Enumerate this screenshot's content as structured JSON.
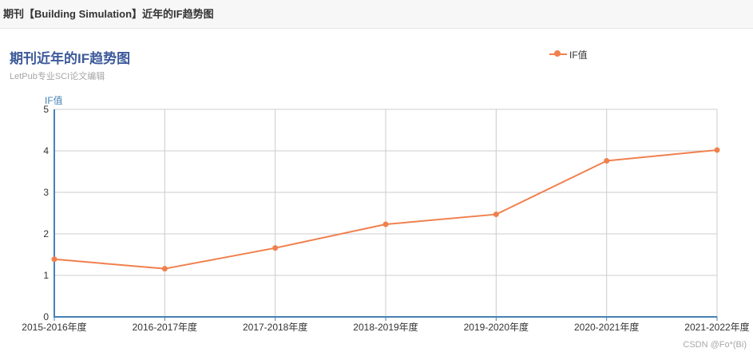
{
  "page_header": {
    "title": "期刊【Building Simulation】近年的IF趋势图"
  },
  "chart_data": {
    "type": "line",
    "title": "期刊近年的IF趋势图",
    "subtitle": "LetPub专业SCI论文编辑",
    "ylabel": "IF值",
    "xlabel": "",
    "categories": [
      "2015-2016年度",
      "2016-2017年度",
      "2017-2018年度",
      "2018-2019年度",
      "2019-2020年度",
      "2020-2021年度",
      "2021-2022年度"
    ],
    "series": [
      {
        "name": "IF值",
        "values": [
          1.39,
          1.16,
          1.66,
          2.23,
          2.47,
          3.76,
          4.02
        ],
        "color": "#f0804d"
      }
    ],
    "ylim": [
      0,
      5
    ],
    "yticks": [
      0,
      1,
      2,
      3,
      4,
      5
    ],
    "grid": true,
    "legend": "top-right"
  },
  "watermark": "CSDN @Fo*(Bi)"
}
